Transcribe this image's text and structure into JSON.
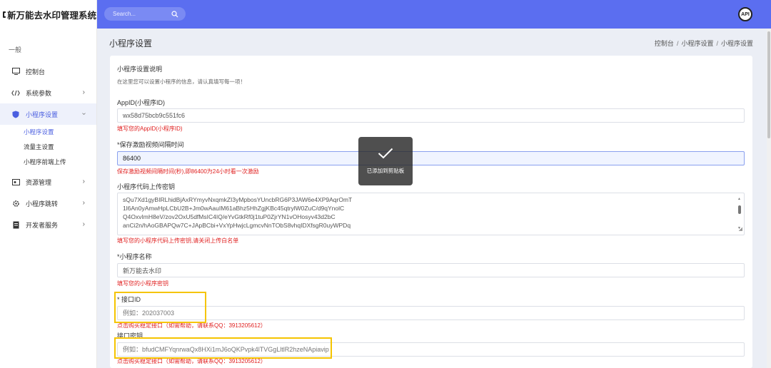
{
  "app": {
    "brand": "新万能去水印管理系统"
  },
  "sidebar": {
    "section": "一般",
    "items": [
      {
        "label": "控制台"
      },
      {
        "label": "系统参数"
      },
      {
        "label": "小程序设置"
      },
      {
        "label": "资源管理"
      },
      {
        "label": "小程序跳转"
      },
      {
        "label": "开发者服务"
      }
    ],
    "sub_items": [
      {
        "label": "小程序设置"
      },
      {
        "label": "流量主设置"
      },
      {
        "label": "小程序前端上传"
      }
    ]
  },
  "header": {
    "search_placeholder": "Search...",
    "api_badge": "API"
  },
  "page": {
    "title": "小程序设置",
    "breadcrumb": [
      "控制台",
      "小程序设置",
      "小程序设置"
    ]
  },
  "card": {
    "title": "小程序设置说明",
    "desc": "在这里您可以设置小程序的信息，请认真填写每一项！"
  },
  "form": {
    "appid": {
      "label": "AppID(小程序ID)",
      "value": "wx58d75bcb9c551fc6",
      "hint": "填写您的AppID(小程序ID)"
    },
    "interval": {
      "label": "*保存激励视频间隔时间",
      "value": "86400",
      "hint": "保存激励视频间隔时间(秒),即86400为24小时看一次激励"
    },
    "upload_key": {
      "label": "小程序代码上传密钥",
      "lines": [
        "sQu7Xd1gyBIRLhidBjAxRYmyvNxqmkZI3yMpbosYUncbRG6P3JAW6e4XP9AqrOmT",
        "1l6An0yAmwHpLCbU2B+Jm0wAauIM61aBhz5HhZgjKBc45qtrylW0ZuC/d9qYnolC",
        "Q4OxvImH8eV/zov2OxU5dfMsIC4IQ/eYvGtkRf0j1tuP0ZjrYN1vOHosyv43d2bC",
        "anCi2n/hAoGBAPQw7C+JApBCbi+VxYpHwjcLgmcvNnTObS8vhqIDXfsgR0uyWPDq"
      ],
      "hint": "填写您的小程序代码上传密钥,请关闭上传白名单"
    },
    "app_name": {
      "label": "*小程序名称",
      "value": "新万能去水印",
      "hint": "填写您的小程序密钥"
    },
    "api_id": {
      "label": "* 接口ID",
      "placeholder": "例如：202037003",
      "hint": "点击购买稳定接口（如需帮助，请联系QQ：3913205612）"
    },
    "api_secret": {
      "label": "接口密钥",
      "placeholder": "例如：bfudCMFYqnrwaQx8HXi1mJ6oQKPvpk4lTVGgLltlR2hzeNApiavip",
      "hint": "点击购买稳定接口（如需帮助，请联系QQ：3913205612）"
    }
  },
  "toast": {
    "text": "已添加到剪贴板"
  },
  "colors": {
    "primary": "#5b6ef0",
    "active": "#4b5fe0",
    "error": "#e02020",
    "highlight": "#f5c400"
  }
}
